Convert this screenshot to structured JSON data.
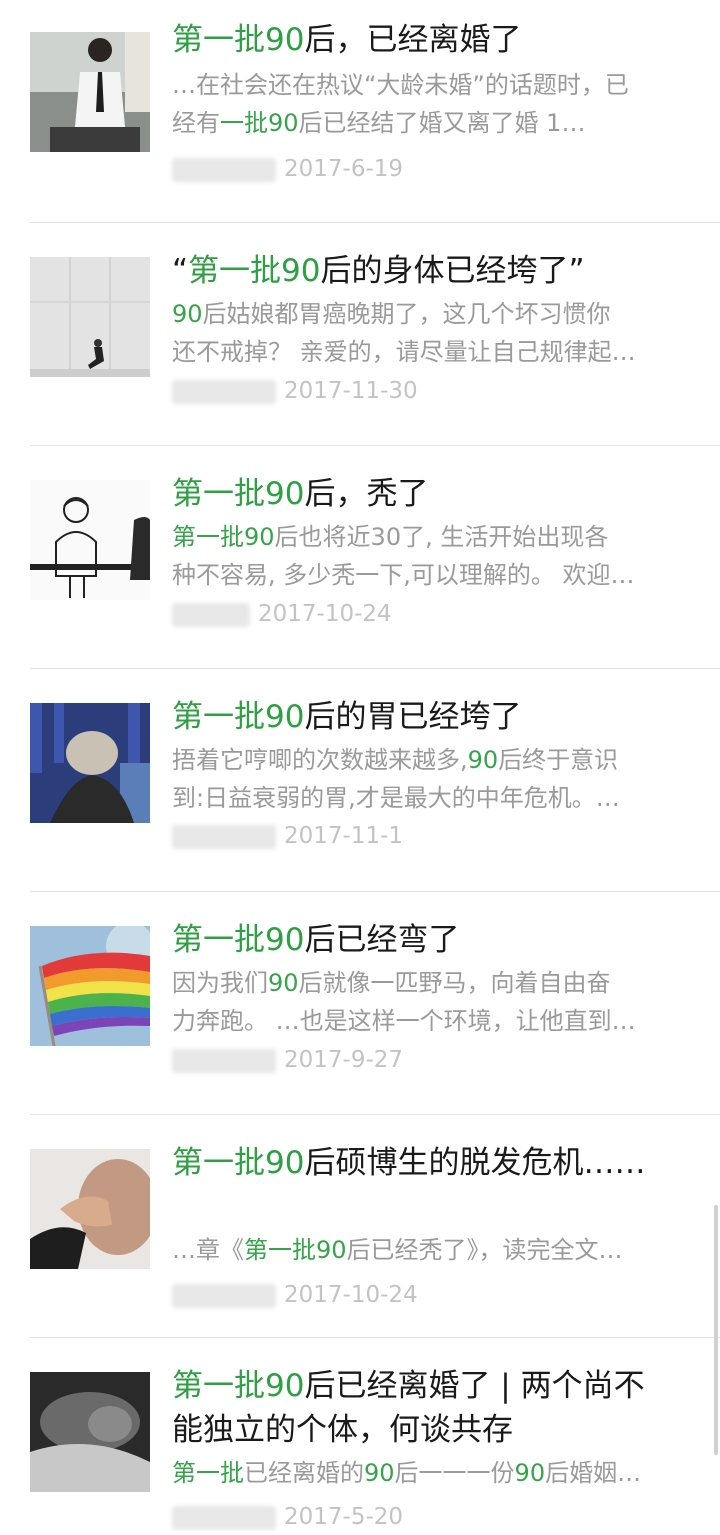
{
  "articles": [
    {
      "title_hl": "第一批90",
      "title_rest": "后，已经离婚了",
      "desc1_parts": [
        "…在社会还在热议“大龄未婚”的话题时，已",
        "",
        ""
      ],
      "desc2_parts": [
        "经有",
        "一批90",
        "后已经结了婚又离了婚 1…"
      ],
      "date": "2017-6-19"
    },
    {
      "title_pre": "“",
      "title_hl": "第一批90",
      "title_rest": "后的身体已经垮了”",
      "desc1_parts": [
        "",
        "90",
        "后姑娘都胃癌晚期了，这几个坏习惯你"
      ],
      "desc2_parts": [
        "还不戒掉？ 亲爱的，请尽量让自己规律起…",
        "",
        ""
      ],
      "date": "2017-11-30"
    },
    {
      "title_hl": "第一批90",
      "title_rest": "后，秃了",
      "desc1_parts": [
        "",
        "第一批90",
        "后也将近30了, 生活开始出现各"
      ],
      "desc2_parts": [
        "种不容易, 多少秃一下,可以理解的。 欢迎…",
        "",
        ""
      ],
      "date": "2017-10-24"
    },
    {
      "title_hl": "第一批90",
      "title_rest": "后的胃已经垮了",
      "desc1_parts": [
        "捂着它哼唧的次数越来越多,",
        "90",
        "后终于意识"
      ],
      "desc2_parts": [
        "到:日益衰弱的胃,才是最大的中年危机。…",
        "",
        ""
      ],
      "date": "2017-11-1"
    },
    {
      "title_hl": "第一批90",
      "title_rest": "后已经弯了",
      "desc1_parts": [
        "因为我们",
        "90",
        "后就像一匹野马，向着自由奋"
      ],
      "desc2_parts": [
        "力奔跑。 …也是这样一个环境，让他直到…",
        "",
        ""
      ],
      "date": "2017-9-27"
    },
    {
      "title_hl": "第一批90",
      "title_rest": "后硕博生的脱发危机……",
      "desc1_parts": [
        "…章《",
        "第一批90",
        "后已经秃了》，读完全文…"
      ],
      "date": "2017-10-24"
    },
    {
      "title_hl": "第一批90",
      "title_rest": "后已经离婚了 | 两个尚不",
      "title_line2": "能独立的个体，何谈共存",
      "desc1_parts": [
        "",
        "第一批",
        "已经离婚的"
      ],
      "desc1_hl2": "90",
      "desc1_tail": "后一一一份",
      "desc1_hl3": "90",
      "desc1_tail2": "后婚姻…",
      "date": "2017-5-20"
    }
  ],
  "colors": {
    "accent": "#2ea043",
    "divider": "#e4e4e4"
  },
  "icons": [
    "article-thumbnail"
  ]
}
